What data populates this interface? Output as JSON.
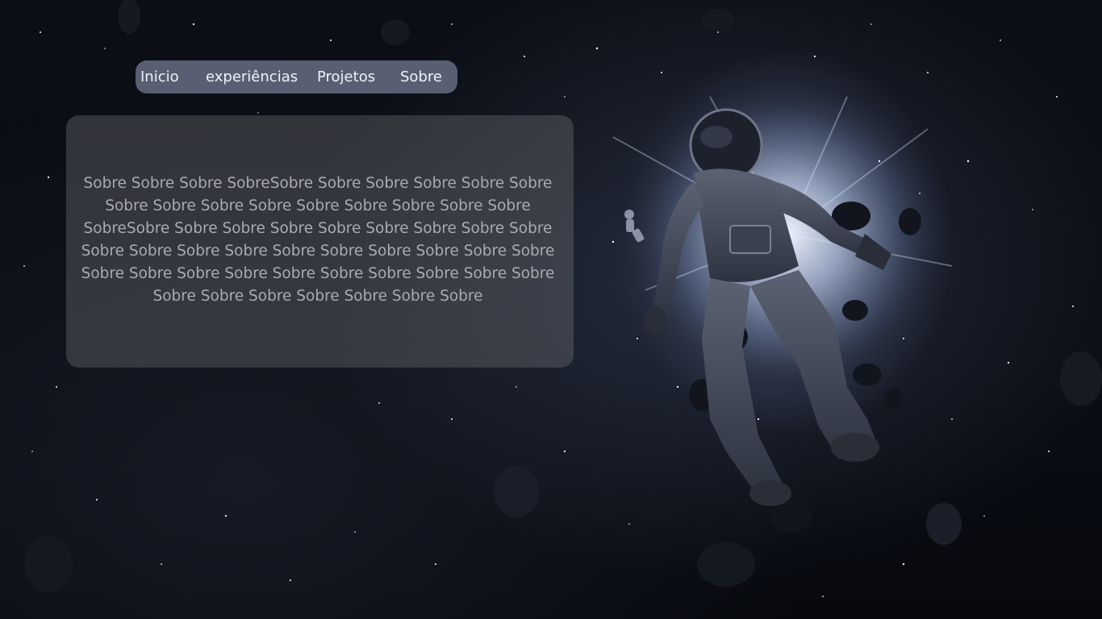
{
  "nav": {
    "items": [
      {
        "label": "Inicio"
      },
      {
        "label": "experiências"
      },
      {
        "label": "Projetos"
      },
      {
        "label": "Sobre"
      }
    ]
  },
  "about": {
    "text": "Sobre Sobre Sobre SobreSobre Sobre Sobre Sobre Sobre Sobre Sobre Sobre Sobre Sobre Sobre Sobre Sobre Sobre Sobre SobreSobre Sobre Sobre Sobre Sobre Sobre Sobre Sobre Sobre Sobre Sobre Sobre Sobre Sobre Sobre Sobre Sobre Sobre Sobre Sobre Sobre Sobre Sobre Sobre Sobre Sobre Sobre Sobre Sobre Sobre Sobre Sobre Sobre Sobre Sobre Sobre"
  },
  "colors": {
    "nav_background": "#5d6478",
    "nav_text": "#ffffff",
    "panel_background": "rgba(110,110,115,0.40)",
    "panel_text": "#a9abb1"
  },
  "background": {
    "subject": "astronaut-floating-in-space-illustration"
  }
}
